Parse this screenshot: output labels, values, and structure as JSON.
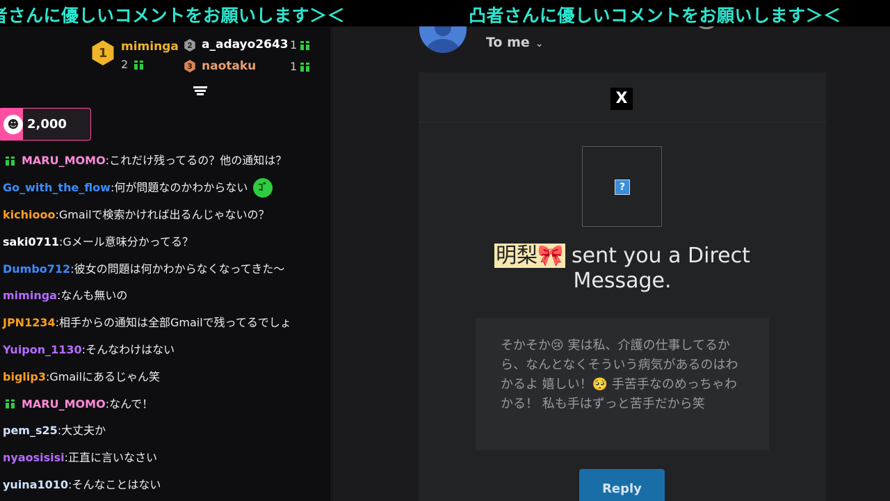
{
  "ticker": {
    "text1": "者さんに優しいコメントをお願いします＞＜",
    "text2": "凸者さんに優しいコメントをお願いします＞＜",
    "color": "#2ee6d0"
  },
  "leaderboard": {
    "first": {
      "rank": "1",
      "name": "miminga",
      "count": "2",
      "color": "#f0b429"
    },
    "second": {
      "rank": "2",
      "name": "a_adayo2643",
      "count": "1",
      "color": "#ffffff"
    },
    "third": {
      "rank": "3",
      "name": "naotaku",
      "count": "1",
      "color": "#e8a06e"
    }
  },
  "pinned": {
    "emote": "☻",
    "amount": "2,000"
  },
  "messages": [
    {
      "user": "MARU_MOMO",
      "color": "#ff8ad8",
      "text": "これだけ残ってるの？他の通知は？",
      "gift": true
    },
    {
      "user": "Go_with_the_flow",
      "color": "#3b8cff",
      "text": "何が問題なのかわからない",
      "emote": "ｺﾞ"
    },
    {
      "user": "kichiooo",
      "color": "#ff9f1c",
      "text": "Gmailで検索かければ出るんじゃないの？"
    },
    {
      "user": "saki0711",
      "color": "#ffffff",
      "text": "Gメール意味分かってる？"
    },
    {
      "user": "Dumbo712",
      "color": "#3b8cff",
      "text": "彼女の問題は何かわからなくなってきた〜"
    },
    {
      "user": "miminga",
      "color": "#b46cff",
      "text": "なんも無いの"
    },
    {
      "user": "JPN1234",
      "color": "#ff9f1c",
      "text": "相手からの通知は全部Gmailで残ってるでしょ"
    },
    {
      "user": "Yuipon_1130",
      "color": "#b46cff",
      "text": "そんなわけはない"
    },
    {
      "user": "biglip3",
      "color": "#ff9f1c",
      "text": "Gmailにあるじゃん笑"
    },
    {
      "user": "MARU_MOMO",
      "color": "#ff8ad8",
      "text": "なんで！",
      "gift": true
    },
    {
      "user": "pem_s25",
      "color": "#cfe3ff",
      "text": "大丈夫か"
    },
    {
      "user": "nyaosisisi",
      "color": "#b46cff",
      "text": "正直に言いなさい"
    },
    {
      "user": "yuina1010",
      "color": "#cfe3ff",
      "text": "そんなことはない"
    }
  ],
  "email": {
    "recipient": "To me",
    "chevron": "⌄",
    "logo": "X",
    "image_placeholder": "?",
    "sender": "明梨🎀",
    "line1": " sent you a Direct",
    "line2": "Message.",
    "message": "そかそか😢 実は私、介護の仕事してるから、なんとなくそういう病気があるのはわかるよ 嬉しい！🥺 手苦手なのめっちゃわかる！ 私も手はずっと苦手だから笑",
    "reply_label": "Reply",
    "reply_color": "#1a6ea8"
  }
}
